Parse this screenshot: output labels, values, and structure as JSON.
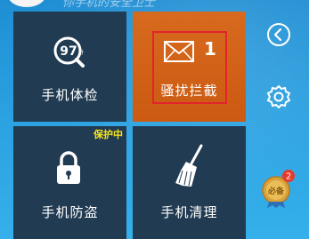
{
  "header": {
    "title": "你手机的安全卫士"
  },
  "tiles": {
    "phone_check": {
      "label": "手机体检",
      "score": "97",
      "score_unit": "分",
      "icon": "score-magnifier-icon"
    },
    "harassment_block": {
      "label": "骚扰拦截",
      "count": "1",
      "icon": "envelope-icon"
    },
    "anti_theft": {
      "label": "手机防盗",
      "status": "保护中",
      "icon": "lock-icon"
    },
    "phone_clean": {
      "label": "手机清理",
      "icon": "broom-icon"
    }
  },
  "sidebar": {
    "back_icon": "chevron-left-icon",
    "settings_icon": "gear-icon",
    "badge_icon": "medal-icon",
    "badge_count": "2",
    "badge_text": "必备"
  },
  "colors": {
    "background": "#2aa0e0",
    "tile_dark": "#213b52",
    "tile_orange": "#cc5a12",
    "highlight": "#e2242c",
    "status_yellow": "#f4e31c",
    "badge_red": "#e8392b"
  }
}
